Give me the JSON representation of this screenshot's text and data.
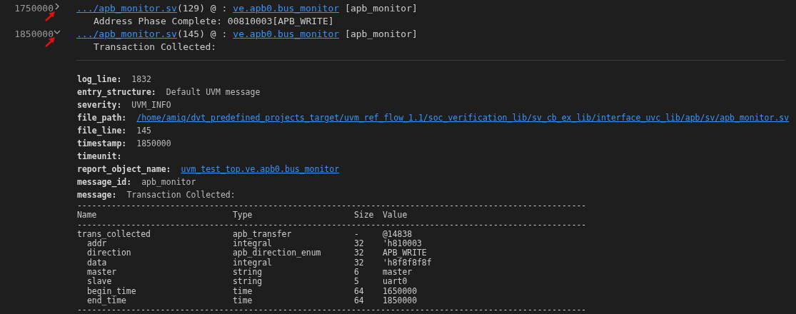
{
  "entries": [
    {
      "time": "1750000",
      "expanded": false,
      "file_link": ".../apb_monitor.sv",
      "location": "(129) @ :",
      "scope_link": "ve.apb0.bus_monitor",
      "tag": "[apb_monitor]",
      "message": "Address Phase Complete: 00810003[APB_WRITE]"
    },
    {
      "time": "1850000",
      "expanded": true,
      "file_link": ".../apb_monitor.sv",
      "location": "(145) @ :",
      "scope_link": "ve.apb0.bus_monitor",
      "tag": "[apb_monitor]",
      "message": "Transaction Collected:"
    }
  ],
  "details": [
    {
      "key": "log_line:",
      "value": "1832",
      "kind": "text"
    },
    {
      "key": "entry_structure:",
      "value": "Default UVM message",
      "kind": "text"
    },
    {
      "key": "severity:",
      "value": "UVM_INFO",
      "kind": "text"
    },
    {
      "key": "file_path:",
      "value": "/home/amiq/dvt_predefined_projects_target/uvm_ref_flow_1.1/soc_verification_lib/sv_cb_ex_lib/interface_uvc_lib/apb/sv/apb_monitor.sv",
      "kind": "link"
    },
    {
      "key": "file_line:",
      "value": "145",
      "kind": "text"
    },
    {
      "key": "timestamp:",
      "value": "1850000",
      "kind": "text"
    },
    {
      "key": "timeunit:"
    },
    {
      "key": "report_object_name:",
      "value": "uvm_test_top.ve.apb0.bus_monitor",
      "kind": "link"
    },
    {
      "key": "message_id:",
      "value": "apb_monitor",
      "kind": "text"
    },
    {
      "key": "message:",
      "value": "Transaction Collected:",
      "kind": "text"
    }
  ],
  "table": {
    "rule_top": "--------------------------------------------------------------------------------------------------------",
    "columns": [
      "Name",
      "Type",
      "Size",
      "Value"
    ],
    "rule_header": "--------------------------------------------------------------------------------------------------------",
    "rows": [
      {
        "cells": [
          "trans_collected",
          "apb_transfer",
          "-",
          "@14838"
        ],
        "children": [
          {
            "cells": [
              "addr",
              "integral",
              "32",
              "'h810003"
            ]
          },
          {
            "cells": [
              "direction",
              "apb_direction_enum",
              "32",
              "APB_WRITE"
            ]
          },
          {
            "cells": [
              "data",
              "integral",
              "32",
              "'h8f8f8f8f"
            ]
          },
          {
            "cells": [
              "master",
              "string",
              "6",
              "master"
            ]
          },
          {
            "cells": [
              "slave",
              "string",
              "5",
              "uart0"
            ]
          },
          {
            "cells": [
              "begin_time",
              "time",
              "64",
              "1650000"
            ]
          },
          {
            "cells": [
              "end_time",
              "time",
              "64",
              "1850000"
            ]
          }
        ]
      }
    ],
    "rule_bottom": "--------------------------------------------------------------------------------------------------------"
  }
}
